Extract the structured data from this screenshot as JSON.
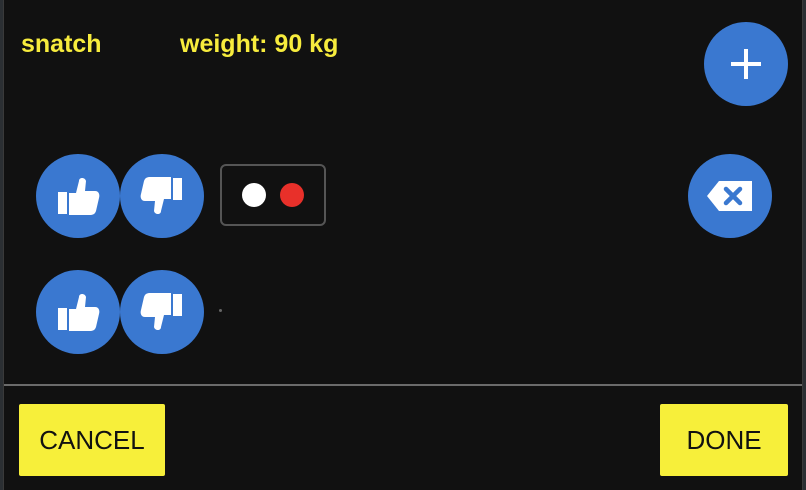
{
  "exercise": {
    "name": "snatch",
    "weight_label": "weight: 90 kg"
  },
  "buttons": {
    "cancel_label": "CANCEL",
    "done_label": "DONE"
  },
  "icons": {
    "add": "plus-icon",
    "delete": "backspace-icon",
    "approve": "thumbs-up-icon",
    "reject": "thumbs-down-icon"
  },
  "indicator": {
    "dots": [
      "white",
      "red"
    ]
  },
  "colors": {
    "dialog_bg": "#111111",
    "accent_text": "#f7ec3d",
    "button_blue": "#3a78d0",
    "action_yellow": "#f7ef3a",
    "dot_white": "#ffffff",
    "dot_red": "#e8302a"
  }
}
